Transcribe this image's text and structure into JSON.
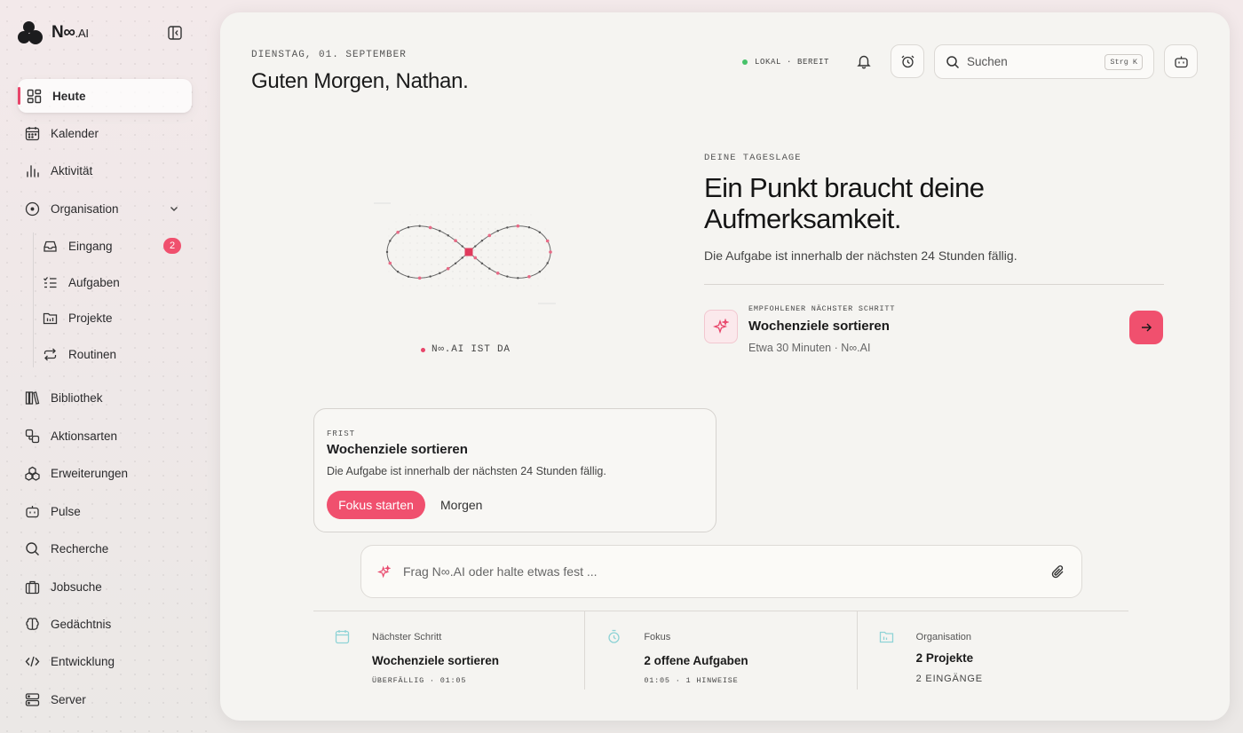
{
  "app": {
    "name": "N∞",
    "name_suffix": ".AI"
  },
  "sidebar": {
    "items": [
      {
        "label": "Heute"
      },
      {
        "label": "Kalender"
      },
      {
        "label": "Aktivität"
      },
      {
        "label": "Organisation"
      },
      {
        "label": "Eingang",
        "badge": "2"
      },
      {
        "label": "Aufgaben"
      },
      {
        "label": "Projekte"
      },
      {
        "label": "Routinen"
      },
      {
        "label": "Bibliothek"
      },
      {
        "label": "Aktionsarten"
      },
      {
        "label": "Erweiterungen"
      },
      {
        "label": "Pulse"
      },
      {
        "label": "Recherche"
      },
      {
        "label": "Jobsuche"
      },
      {
        "label": "Gedächtnis"
      },
      {
        "label": "Entwicklung"
      },
      {
        "label": "Server"
      }
    ]
  },
  "header": {
    "date": "DIENSTAG, 01. SEPTEMBER",
    "greeting": "Guten Morgen, Nathan.",
    "status": "LOKAL · BEREIT",
    "search_placeholder": "Suchen",
    "search_shortcut": "Strg K"
  },
  "visual": {
    "label": "N∞.AI IST DA"
  },
  "briefing": {
    "label": "DEINE TAGESLAGE",
    "headline": "Ein Punkt braucht deine Aufmerksamkeit.",
    "subline": "Die Aufgabe ist innerhalb der nächsten 24 Stunden fällig.",
    "next_label": "EMPFOHLENER NÄCHSTER SCHRITT",
    "next_title": "Wochenziele sortieren",
    "next_meta": "Etwa 30 Minuten · N∞.AI"
  },
  "deadline_card": {
    "label": "FRIST",
    "title": "Wochenziele sortieren",
    "text": "Die Aufgabe ist innerhalb der nächsten 24 Stunden fällig.",
    "primary": "Fokus starten",
    "secondary": "Morgen"
  },
  "ask": {
    "placeholder": "Frag N∞.AI oder halte etwas fest ..."
  },
  "stats": [
    {
      "label": "Nächster Schritt",
      "value": "Wochenziele sortieren",
      "sub": "ÜBERFÄLLIG · 01:05"
    },
    {
      "label": "Fokus",
      "value": "2 offene Aufgaben",
      "sub": "01:05 · 1 HINWEISE"
    },
    {
      "label": "Organisation",
      "value": "2 Projekte",
      "sub": "2 EINGÄNGE"
    }
  ],
  "colors": {
    "accent": "#f0506e",
    "status_ok": "#47c26a",
    "stat_icon": "#8fd3d6"
  }
}
